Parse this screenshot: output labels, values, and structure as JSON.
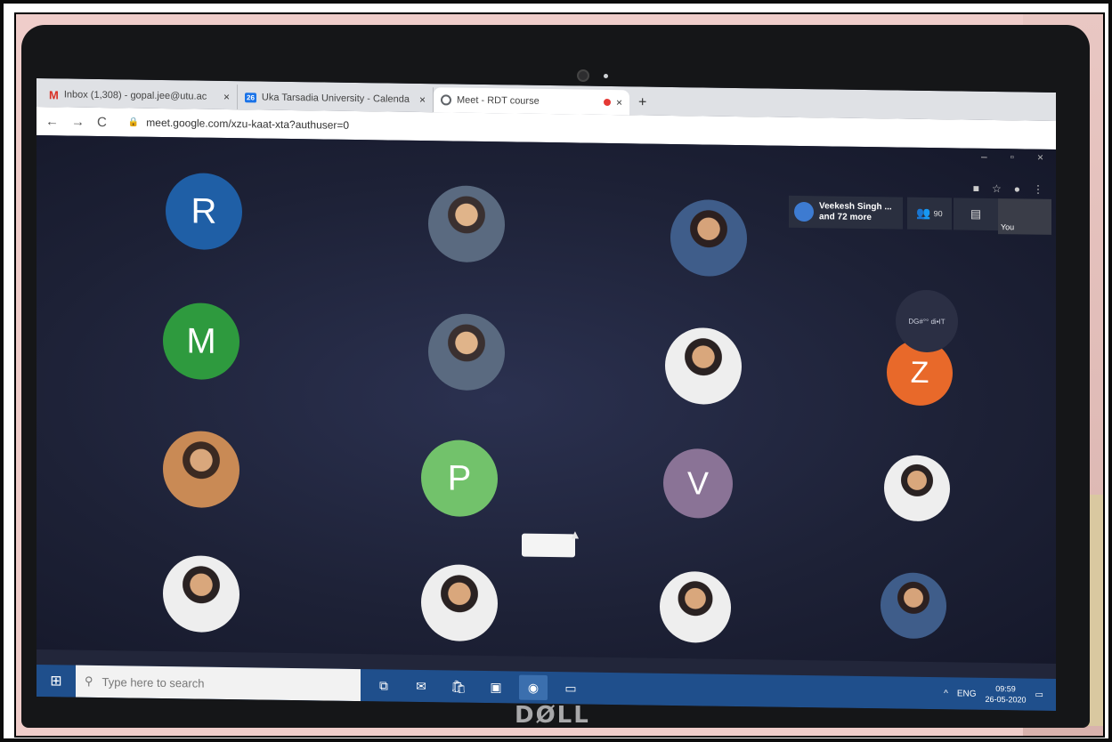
{
  "browser": {
    "tabs": [
      {
        "icon": "M",
        "title": "Inbox (1,308) - gopal.jee@utu.ac",
        "close": "×"
      },
      {
        "icon": "26",
        "title": "Uka Tarsadia University - Calenda",
        "close": "×"
      },
      {
        "icon": "",
        "title": "Meet - RDT course",
        "close": "×"
      }
    ],
    "new_tab": "+",
    "nav": {
      "back": "←",
      "forward": "→",
      "reload": "C"
    },
    "url": "meet.google.com/xzu-kaat-xta?authuser=0",
    "window_controls": {
      "minimize": "–",
      "maximize": "▫",
      "close": "×"
    }
  },
  "meet": {
    "participants_card": {
      "line1": "Veekesh Singh ...",
      "line2": "and 72 more"
    },
    "people_count": "90",
    "self_label": "You",
    "presenting_label": "DG#°° di•IT",
    "tiles": [
      {
        "type": "letter",
        "letter": "R",
        "color": "#1f5fa6"
      },
      {
        "type": "photo"
      },
      {
        "type": "photo"
      },
      {
        "type": "letter",
        "letter": "M",
        "color": "#2e9a3e"
      },
      {
        "type": "photo"
      },
      {
        "type": "photo"
      },
      {
        "type": "letter",
        "letter": "Z",
        "color": "#e8692a"
      },
      {
        "type": "photo"
      },
      {
        "type": "letter",
        "letter": "P",
        "color": "#72c26b"
      },
      {
        "type": "letter",
        "letter": "V",
        "color": "#8a7396"
      },
      {
        "type": "photo"
      },
      {
        "type": "photo"
      },
      {
        "type": "photo"
      },
      {
        "type": "photo"
      },
      {
        "type": "photo"
      }
    ]
  },
  "taskbar": {
    "search_placeholder": "Type here to search",
    "language": "ENG",
    "time": "09:59",
    "date": "26-05-2020"
  },
  "laptop": {
    "brand": "DØLL"
  }
}
